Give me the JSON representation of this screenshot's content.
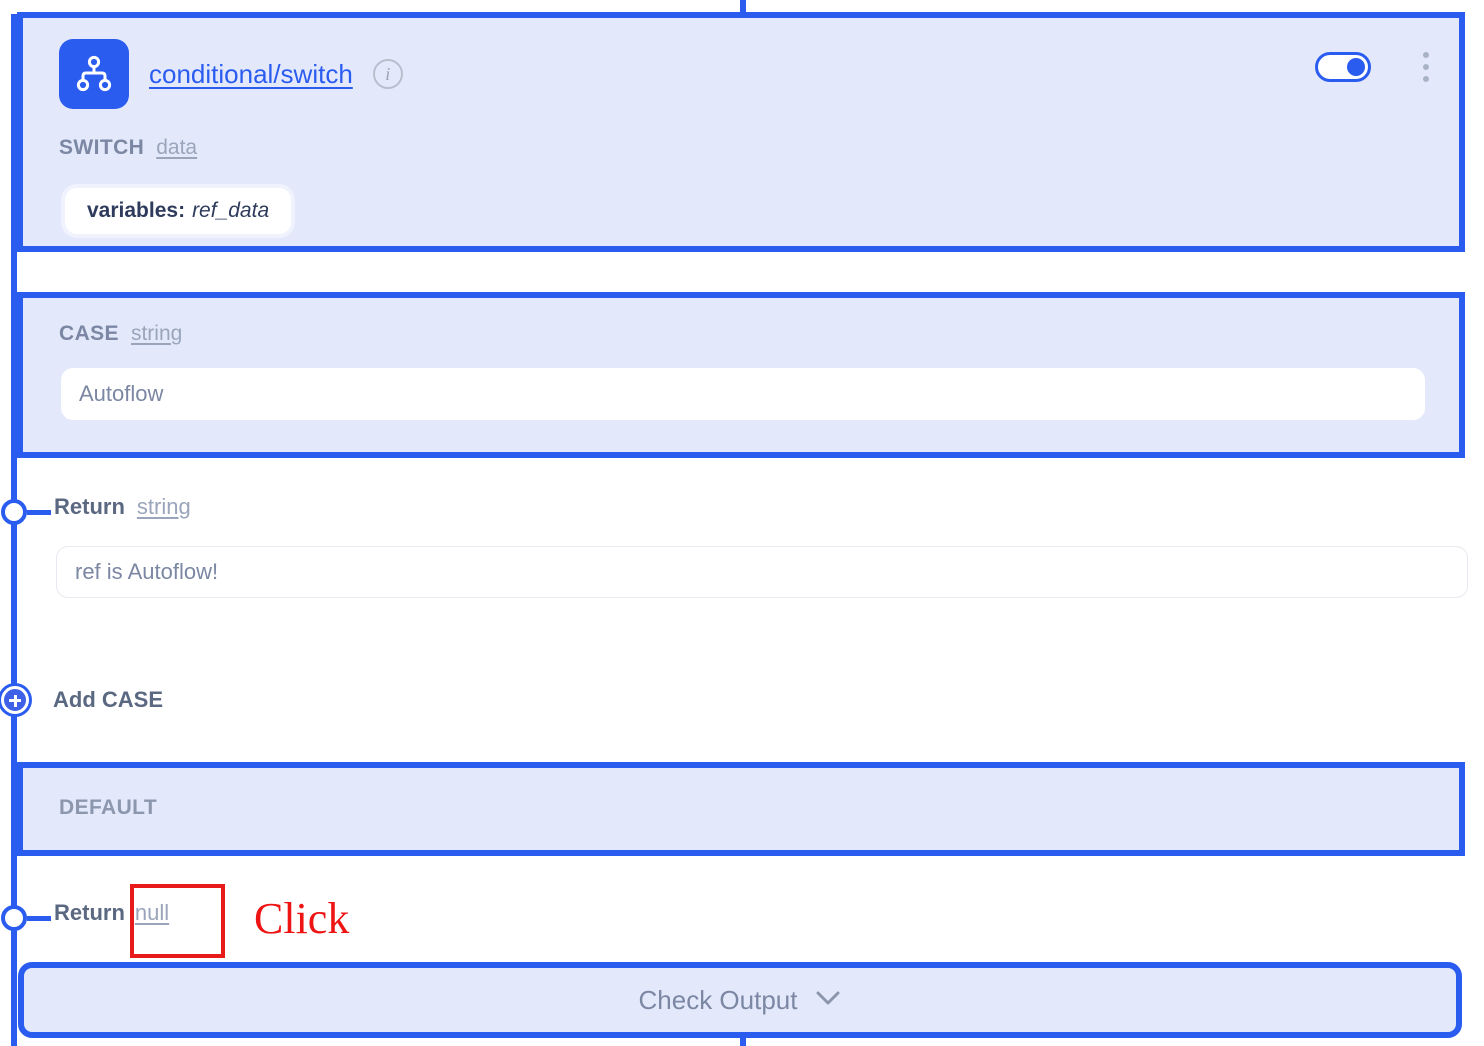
{
  "node": {
    "icon": "hierarchy-switch-icon",
    "title": "conditional/switch",
    "info_icon": "info-circle-icon",
    "enabled_toggle": {
      "state": "on",
      "icon": "toggle-switch-icon"
    },
    "more_menu_icon": "kebab-menu-icon"
  },
  "switch": {
    "keyword": "SWITCH",
    "type": "data",
    "variable": {
      "key": "variables:",
      "value": "ref_data"
    }
  },
  "case": {
    "keyword": "CASE",
    "type": "string",
    "value": "Autoflow",
    "placeholder": "Autoflow",
    "return": {
      "keyword": "Return",
      "type": "string",
      "value": "ref is Autoflow!",
      "placeholder": "ref is Autoflow!"
    }
  },
  "add_case": {
    "label": "Add CASE",
    "icon": "plus-circle-icon"
  },
  "default": {
    "keyword": "DEFAULT",
    "return": {
      "keyword": "Return",
      "type": "null"
    }
  },
  "annotation": {
    "label": "Click",
    "color": "#ef1414"
  },
  "check_output": {
    "label": "Check Output",
    "icon": "chevron-down-icon"
  },
  "colors": {
    "accent": "#2b5cf0",
    "panel_bg": "#e3e9fb",
    "muted_text": "#7b87a3",
    "annotation_red": "#ef1414"
  }
}
